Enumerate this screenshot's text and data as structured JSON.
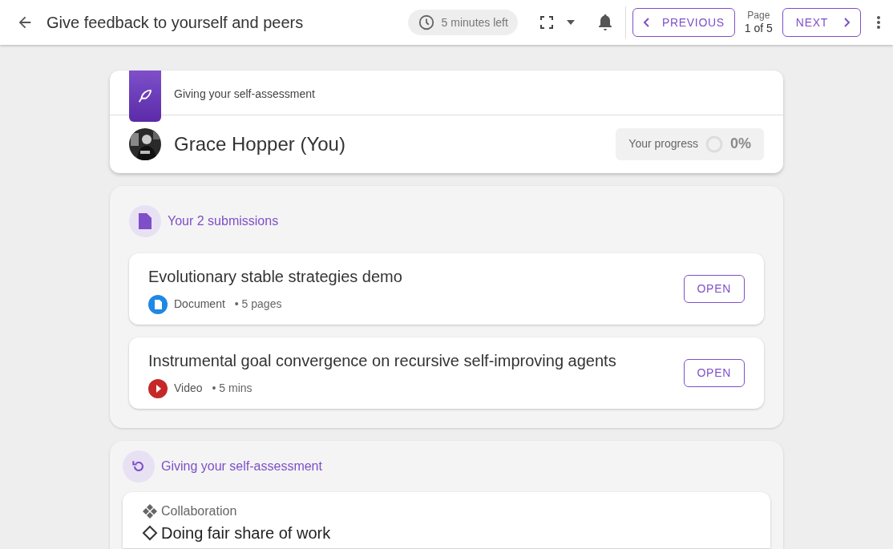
{
  "header": {
    "title": "Give feedback to yourself and peers",
    "timer": "5 minutes left",
    "previous": "PREVIOUS",
    "page_label": "Page",
    "page_count": "1 of 5",
    "next": "NEXT"
  },
  "assessment_card": {
    "caption": "Giving your self-assessment",
    "name": "Grace Hopper (You)",
    "progress_label": "Your progress",
    "progress": {
      "level": 0,
      "reading": "0%"
    }
  },
  "submissions": {
    "title": "Your 2 submissions",
    "items": [
      {
        "title": "Evolutionary stable strategies demo",
        "kind": "document",
        "type": "Document",
        "detail": "• 5 pages",
        "action": "OPEN"
      },
      {
        "title": "Instrumental goal convergence on recursive self-improving agents",
        "kind": "video",
        "type": "Video",
        "detail": "• 5 mins",
        "action": "OPEN"
      }
    ]
  },
  "self_assessment": {
    "title": "Giving your self-assessment",
    "category": "Collaboration",
    "criterion": "Doing fair share of work"
  }
}
